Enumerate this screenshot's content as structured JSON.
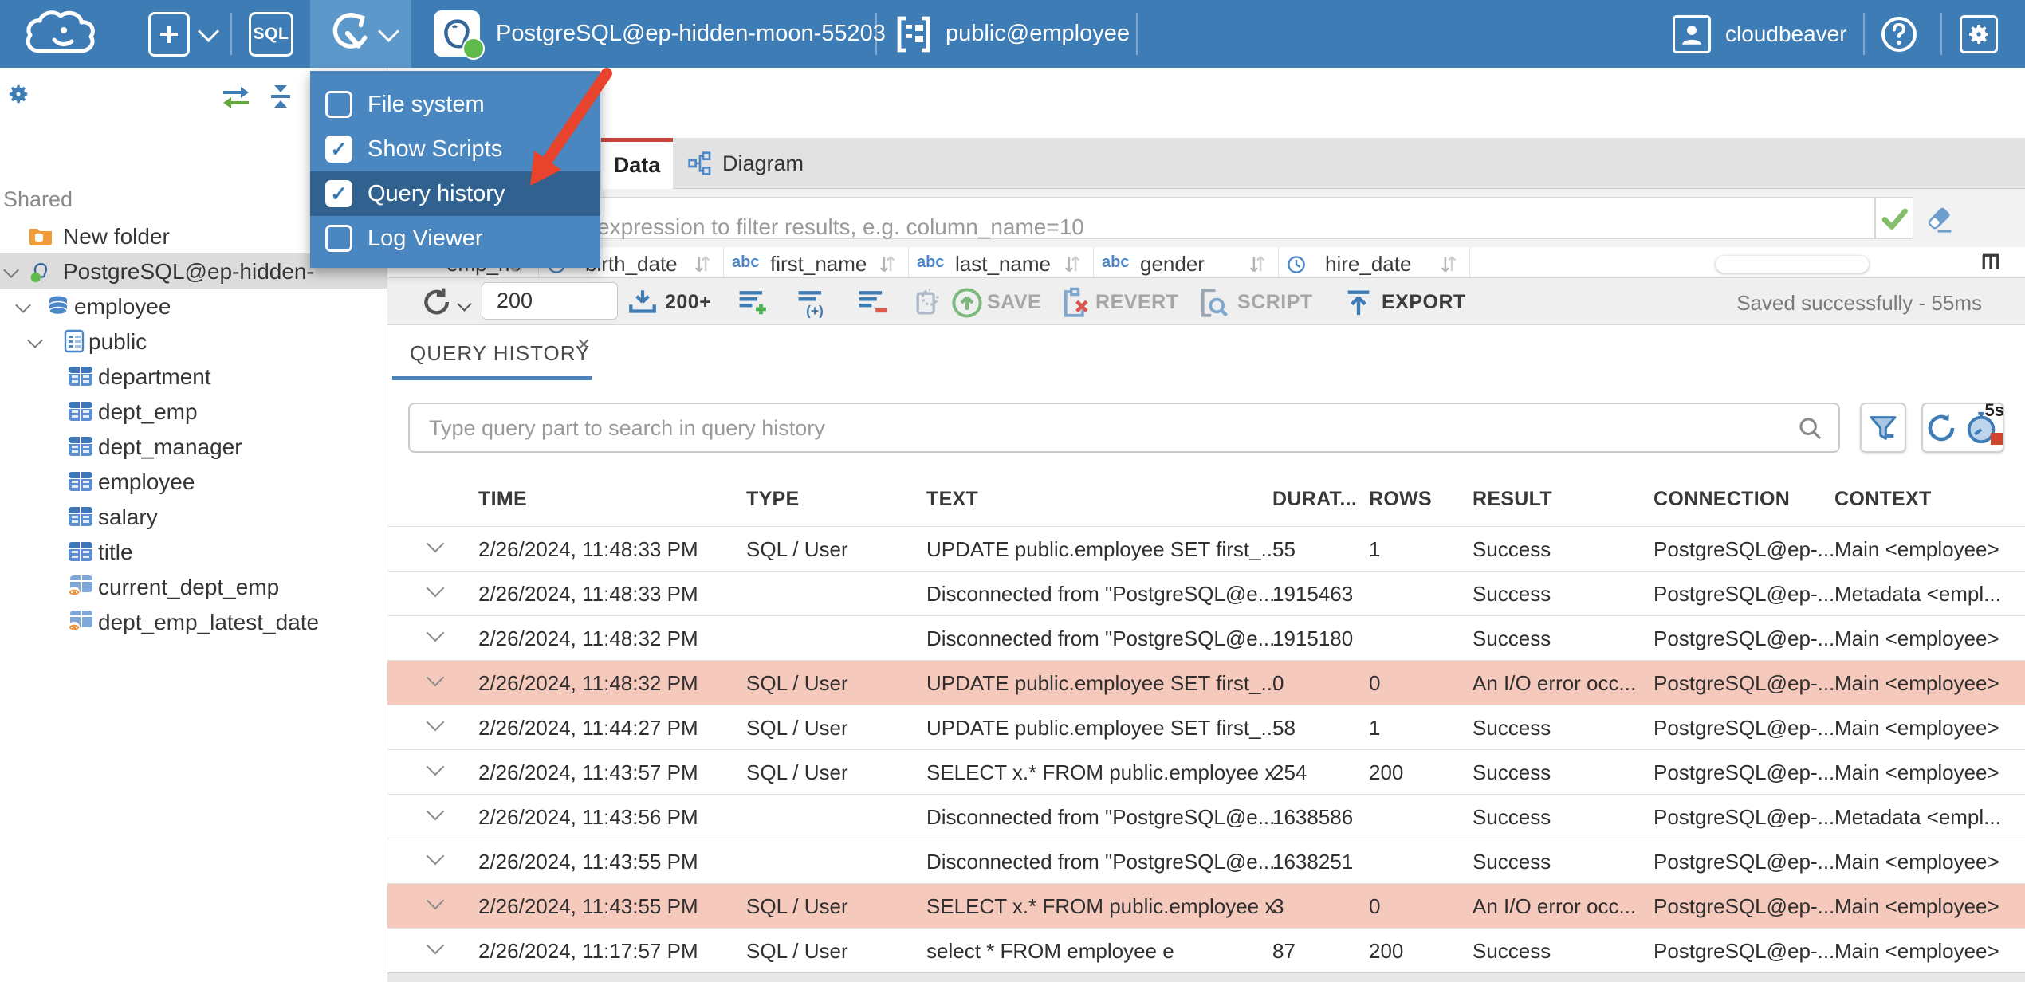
{
  "colors": {
    "header_blue": "#3E7CB6",
    "header_active_blue": "#5D98CA",
    "menu_blue": "#4A86C0",
    "menu_highlight_blue": "#31618F",
    "tab_accent_red": "#C9413A",
    "qh_tab_underline": "#4A81B8",
    "error_row_bg": "#F6C9BD",
    "status_green_dot": "#5FBA4C",
    "arrow_red": "#E8432C"
  },
  "header": {
    "sql_label": "SQL",
    "connection": "PostgreSQL@ep-hidden-moon-55203",
    "schema": "public@employee",
    "user": "cloudbeaver"
  },
  "tools_menu": {
    "items": [
      {
        "label": "File system",
        "checked": false,
        "highlighted": false
      },
      {
        "label": "Show Scripts",
        "checked": true,
        "highlighted": false
      },
      {
        "label": "Query history",
        "checked": true,
        "highlighted": true
      },
      {
        "label": "Log Viewer",
        "checked": false,
        "highlighted": false
      }
    ]
  },
  "sidebar": {
    "section_label": "Shared",
    "tree": [
      {
        "label": "New folder",
        "icon": "folder-database-icon",
        "depth": 0,
        "chevron": false,
        "selected": false
      },
      {
        "label": "PostgreSQL@ep-hidden-",
        "icon": "postgres-icon",
        "depth": 0,
        "chevron": true,
        "selected": true
      },
      {
        "label": "employee",
        "icon": "database-icon",
        "depth": 1,
        "chevron": true,
        "selected": false
      },
      {
        "label": "public",
        "icon": "schema-icon",
        "depth": 2,
        "chevron": true,
        "selected": false
      },
      {
        "label": "department",
        "icon": "table-icon",
        "depth": 3,
        "chevron": false,
        "selected": false
      },
      {
        "label": "dept_emp",
        "icon": "table-icon",
        "depth": 3,
        "chevron": false,
        "selected": false
      },
      {
        "label": "dept_manager",
        "icon": "table-icon",
        "depth": 3,
        "chevron": false,
        "selected": false
      },
      {
        "label": "employee",
        "icon": "table-icon",
        "depth": 3,
        "chevron": false,
        "selected": false
      },
      {
        "label": "salary",
        "icon": "table-icon",
        "depth": 3,
        "chevron": false,
        "selected": false
      },
      {
        "label": "title",
        "icon": "table-icon",
        "depth": 3,
        "chevron": false,
        "selected": false
      },
      {
        "label": "current_dept_emp",
        "icon": "view-icon",
        "depth": 3,
        "chevron": false,
        "selected": false
      },
      {
        "label": "dept_emp_latest_date",
        "icon": "view-icon",
        "depth": 3,
        "chevron": false,
        "selected": false
      }
    ]
  },
  "main": {
    "tabs": [
      {
        "label": "Data",
        "active": true
      },
      {
        "label": "Diagram",
        "active": false
      }
    ],
    "filter_placeholder": "expression to filter results, e.g. column_name=10",
    "grid_columns": [
      {
        "type_label": "123",
        "name": "emp_no"
      },
      {
        "type_label": "clock",
        "name": "birth_date"
      },
      {
        "type_label": "abc",
        "name": "first_name"
      },
      {
        "type_label": "abc",
        "name": "last_name"
      },
      {
        "type_label": "abc",
        "name": "gender"
      },
      {
        "type_label": "clock",
        "name": "hire_date"
      }
    ],
    "toolbar": {
      "fetch_size": "200",
      "fetch_more_label": "200+",
      "save_label": "SAVE",
      "revert_label": "REVERT",
      "script_label": "SCRIPT",
      "export_label": "EXPORT",
      "status": "Saved successfully - 55ms"
    }
  },
  "query_history": {
    "tab_label": "QUERY HISTORY",
    "close_label": "×",
    "search_placeholder": "Type query part to search in query history",
    "refresh_interval_label": "5s",
    "columns": [
      "TIME",
      "TYPE",
      "TEXT",
      "DURAT...",
      "ROWS",
      "RESULT",
      "CONNECTION",
      "CONTEXT"
    ],
    "rows": [
      {
        "time": "2/26/2024, 11:48:33 PM",
        "type": "SQL / User",
        "text": "UPDATE public.employee SET first_...",
        "duration": "55",
        "rows": "1",
        "result": "Success",
        "connection": "PostgreSQL@ep-...",
        "context": "Main <employee>",
        "error": false
      },
      {
        "time": "2/26/2024, 11:48:33 PM",
        "type": "",
        "text": "Disconnected from \"PostgreSQL@e...",
        "duration": "1915463",
        "rows": "",
        "result": "Success",
        "connection": "PostgreSQL@ep-...",
        "context": "Metadata <empl...",
        "error": false
      },
      {
        "time": "2/26/2024, 11:48:32 PM",
        "type": "",
        "text": "Disconnected from \"PostgreSQL@e...",
        "duration": "1915180",
        "rows": "",
        "result": "Success",
        "connection": "PostgreSQL@ep-...",
        "context": "Main <employee>",
        "error": false
      },
      {
        "time": "2/26/2024, 11:48:32 PM",
        "type": "SQL / User",
        "text": "UPDATE public.employee SET first_...",
        "duration": "0",
        "rows": "0",
        "result": "An I/O error occ...",
        "connection": "PostgreSQL@ep-...",
        "context": "Main <employee>",
        "error": true
      },
      {
        "time": "2/26/2024, 11:44:27 PM",
        "type": "SQL / User",
        "text": "UPDATE public.employee SET first_...",
        "duration": "58",
        "rows": "1",
        "result": "Success",
        "connection": "PostgreSQL@ep-...",
        "context": "Main <employee>",
        "error": false
      },
      {
        "time": "2/26/2024, 11:43:57 PM",
        "type": "SQL / User",
        "text": "SELECT x.* FROM public.employee x",
        "duration": "254",
        "rows": "200",
        "result": "Success",
        "connection": "PostgreSQL@ep-...",
        "context": "Main <employee>",
        "error": false
      },
      {
        "time": "2/26/2024, 11:43:56 PM",
        "type": "",
        "text": "Disconnected from \"PostgreSQL@e...",
        "duration": "1638586",
        "rows": "",
        "result": "Success",
        "connection": "PostgreSQL@ep-...",
        "context": "Metadata <empl...",
        "error": false
      },
      {
        "time": "2/26/2024, 11:43:55 PM",
        "type": "",
        "text": "Disconnected from \"PostgreSQL@e...",
        "duration": "1638251",
        "rows": "",
        "result": "Success",
        "connection": "PostgreSQL@ep-...",
        "context": "Main <employee>",
        "error": false
      },
      {
        "time": "2/26/2024, 11:43:55 PM",
        "type": "SQL / User",
        "text": "SELECT x.* FROM public.employee x",
        "duration": "3",
        "rows": "0",
        "result": "An I/O error occ...",
        "connection": "PostgreSQL@ep-...",
        "context": "Main <employee>",
        "error": true
      },
      {
        "time": "2/26/2024, 11:17:57 PM",
        "type": "SQL / User",
        "text": "select * FROM employee e",
        "duration": "87",
        "rows": "200",
        "result": "Success",
        "connection": "PostgreSQL@ep-...",
        "context": "Main <employee>",
        "error": false
      }
    ]
  }
}
